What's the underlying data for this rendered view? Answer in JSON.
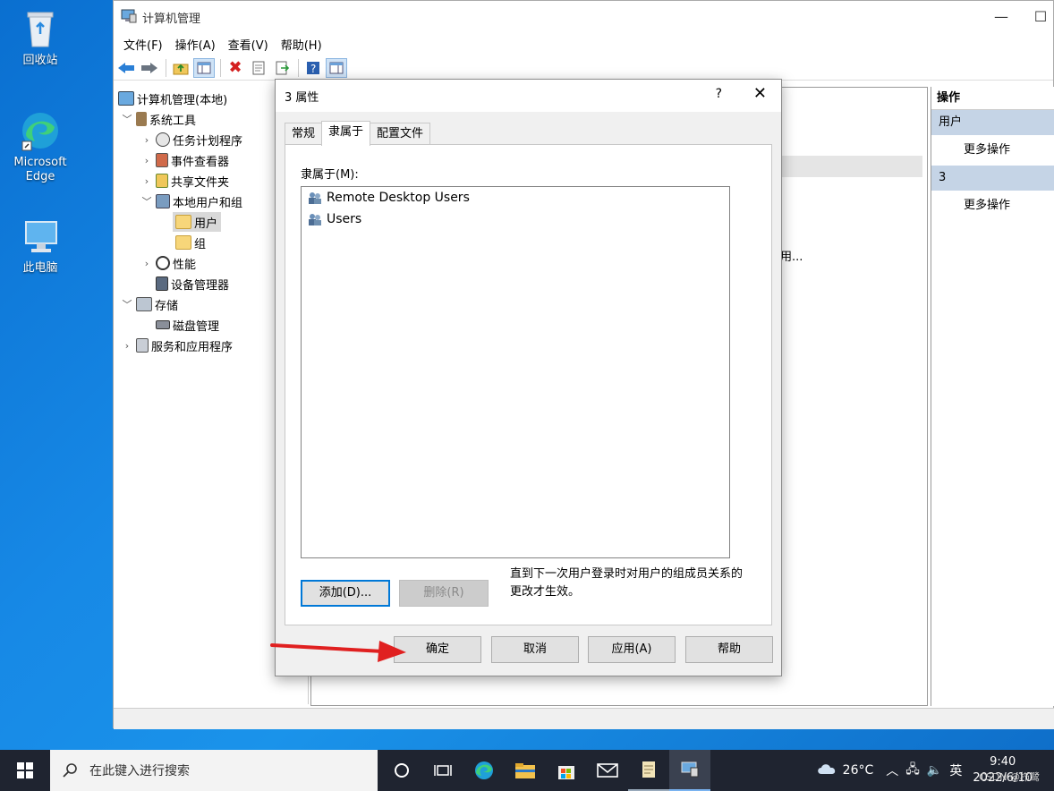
{
  "desktop": {
    "icons": [
      {
        "label": "回收站"
      },
      {
        "label": "Microsoft Edge"
      },
      {
        "label": "此电脑"
      }
    ]
  },
  "window": {
    "title": "计算机管理",
    "menu": [
      "文件(F)",
      "操作(A)",
      "查看(V)",
      "帮助(H)"
    ],
    "tree": [
      {
        "label": "计算机管理(本地)"
      },
      {
        "label": "系统工具"
      },
      {
        "label": "任务计划程序"
      },
      {
        "label": "事件查看器"
      },
      {
        "label": "共享文件夹"
      },
      {
        "label": "本地用户和组"
      },
      {
        "label": "用户"
      },
      {
        "label": "组"
      },
      {
        "label": "性能"
      },
      {
        "label": "设备管理器"
      },
      {
        "label": "存储"
      },
      {
        "label": "磁盘管理"
      },
      {
        "label": "服务和应用程序"
      }
    ],
    "mid_fragment": "用...",
    "actions": {
      "header": "操作",
      "sections": [
        {
          "title": "用户",
          "item": "更多操作"
        },
        {
          "title": "3",
          "item": "更多操作"
        }
      ]
    }
  },
  "dialog": {
    "title": "3 属性",
    "help": "?",
    "close": "✕",
    "tabs": [
      "常规",
      "隶属于",
      "配置文件"
    ],
    "active_tab": "隶属于",
    "member_label": "隶属于(M):",
    "members": [
      "Remote Desktop Users",
      "Users"
    ],
    "add_button": "添加(D)...",
    "remove_button": "删除(R)",
    "note": "直到下一次用户登录时对用户的组成员关系的更改才生效。",
    "ok": "确定",
    "cancel": "取消",
    "apply": "应用(A)",
    "help_button": "帮助"
  },
  "taskbar": {
    "search_placeholder": "在此键入进行搜索",
    "weather": "26°C",
    "ime": "英",
    "time": "9:40",
    "date": "2022/6/10",
    "watermark": "CSDN @栉鹭"
  },
  "colors": {
    "accent": "#0078d7",
    "arrow": "#e02020",
    "action_section": "#c5d4e6"
  }
}
